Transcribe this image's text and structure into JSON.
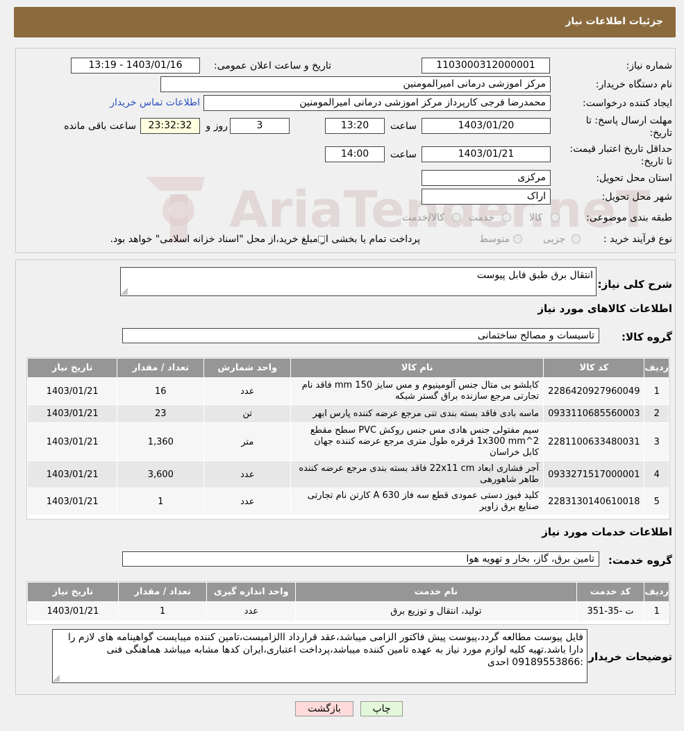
{
  "header": {
    "title": "جزئیات اطلاعات نیاز"
  },
  "info": {
    "need_number_label": "شماره نیاز:",
    "need_number": "1103000312000001",
    "announce_label": "تاریخ و ساعت اعلان عمومی:",
    "announce_value": "1403/01/16 - 13:19",
    "buyer_org_label": "نام دستگاه خریدار:",
    "buyer_org": "مرکز اموزشی درمانی امیرالمومنین",
    "creator_label": "ایجاد کننده درخواست:",
    "creator": "محمدرضا فرجی کارپرداز مرکز اموزشی درمانی امیرالمومنین",
    "contact_link": "اطلاعات تماس خریدار",
    "deadline_label": "مهلت ارسال پاسخ: تا تاریخ:",
    "deadline_date": "1403/01/20",
    "time_label": "ساعت",
    "deadline_time": "13:20",
    "days": "3",
    "days_label": "روز و",
    "remaining": "23:32:32",
    "remaining_label": "ساعت باقی مانده",
    "validity_label": "حداقل تاریخ اعتبار قیمت: تا تاریخ:",
    "validity_date": "1403/01/21",
    "validity_time_label": "ساعت",
    "validity_time": "14:00",
    "province_label": "استان محل تحویل:",
    "province": "مرکزی",
    "city_label": "شهر محل تحویل:",
    "city": "اراک",
    "category_label": "طبقه بندی موضوعی:",
    "cat_opt1": "کالا",
    "cat_opt2": "خدمت",
    "cat_opt3": "کالا/خدمت",
    "process_label": "نوع فرآیند خرید :",
    "proc_opt1": "جزیی",
    "proc_opt2": "متوسط",
    "payment_note": "پرداخت تمام یا بخشی از مبلغ خرید،از محل \"اسناد خزانه اسلامی\" خواهد بود."
  },
  "watermark": "AriaTender.neT",
  "summary": {
    "label": "شرح کلی نیاز:",
    "value": "انتقال برق طبق فابل پیوست"
  },
  "goods": {
    "section_title": "اطلاعات کالاهای مورد نیاز",
    "group_label": "گروه کالا:",
    "group_value": "تاسیسات و مصالح ساختمانی",
    "headers": [
      "ردیف",
      "کد کالا",
      "نام کالا",
      "واحد شمارش",
      "تعداد / مقدار",
      "تاریخ نیاز"
    ],
    "rows": [
      {
        "n": "1",
        "code": "2286420927960049",
        "name": "کابلشو بی متال جنس آلومینیوم و مس سایز 150 mm فاقد نام تجارتی مرجع سازنده براق گستر شبکه",
        "unit": "عدد",
        "qty": "16",
        "date": "1403/01/21"
      },
      {
        "n": "2",
        "code": "0933110685560003",
        "name": "ماسه بادی فاقد بسته بندی تنی مرجع عرضه کننده پارس ابهر",
        "unit": "تن",
        "qty": "23",
        "date": "1403/01/21"
      },
      {
        "n": "3",
        "code": "2281100633480031",
        "name": "سیم مفتولی جنس هادی مس جنس روکش PVC سطح مقطع 1x300 mm^2 قرقره طول متری مرجع عرضه کننده جهان کابل خراسان",
        "unit": "متر",
        "qty": "1,360",
        "date": "1403/01/21"
      },
      {
        "n": "4",
        "code": "0933271517000001",
        "name": "آجر فشاری ابعاد 22x11 cm فاقد بسته بندی مرجع عرضه کننده طاهر شاهورهی",
        "unit": "عدد",
        "qty": "3,600",
        "date": "1403/01/21"
      },
      {
        "n": "5",
        "code": "2283130140610018",
        "name": "کلید فیوز دستی عمودی قطع سه فاز A 630 کارتن نام تجارتی صنایع برق زاویر",
        "unit": "عدد",
        "qty": "1",
        "date": "1403/01/21"
      }
    ]
  },
  "services": {
    "section_title": "اطلاعات خدمات مورد نیاز",
    "group_label": "گروه خدمت:",
    "group_value": "تامین برق، گاز، بخار و تهویه هوا",
    "headers": [
      "ردیف",
      "کد خدمت",
      "نام خدمت",
      "واحد اندازه گیری",
      "تعداد / مقدار",
      "تاریخ نیاز"
    ],
    "rows": [
      {
        "n": "1",
        "code": "ت -35-351",
        "name": "تولید، انتقال و توزیع برق",
        "unit": "عدد",
        "qty": "1",
        "date": "1403/01/21"
      }
    ]
  },
  "buyer_notes": {
    "label": "توضیحات خریدار:",
    "value": "فایل پیوست مطالعه گردد،پیوست پیش فاکتور الزامی میباشد،عقد قرارداد االزامیست،تامین کننده میبایست گواهینامه های لازم را دارا باشد.تهیه کلیه لوازم مورد نیاز به عهده تامین کننده میباشد،پرداخت اعتباری،ایران کدها مشابه میباشد هماهنگی فنی :09189553866 احدی"
  },
  "buttons": {
    "print": "چاپ",
    "back": "بازگشت"
  },
  "colors": {
    "header_bg": "#8b6b3e",
    "table_header": "#969696",
    "back_button": "#ffdada",
    "print_button": "#e3f7d9"
  }
}
